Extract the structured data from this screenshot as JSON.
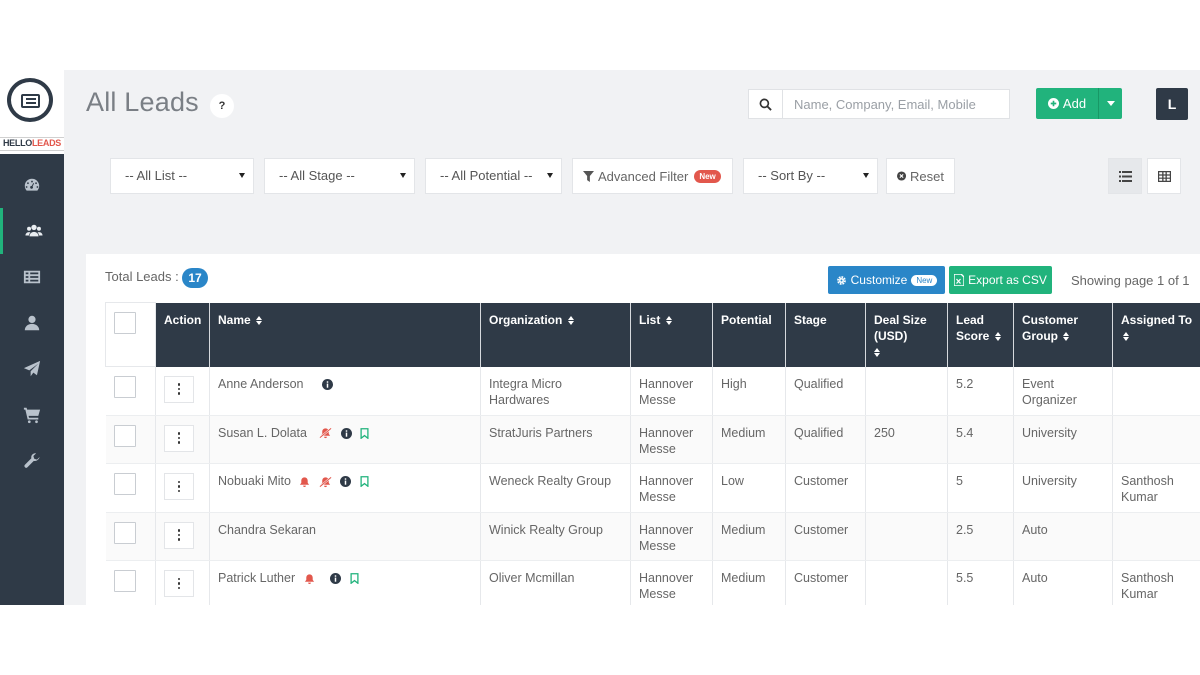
{
  "brand": {
    "name_part1": "HELLO",
    "name_part2": "LEADS"
  },
  "header": {
    "title": "All Leads",
    "help": "?",
    "search_placeholder": "Name, Company, Email, Mobile",
    "add_label": "Add",
    "user_initial": "L"
  },
  "sidebar": {
    "items": [
      {
        "icon": "dashboard-icon"
      },
      {
        "icon": "users-icon",
        "active": true
      },
      {
        "icon": "list-icon"
      },
      {
        "icon": "user-icon"
      },
      {
        "icon": "paper-plane-icon"
      },
      {
        "icon": "cart-icon"
      },
      {
        "icon": "wrench-icon"
      }
    ]
  },
  "filters": {
    "list": "-- All List --",
    "stage": "-- All Stage --",
    "potential": "-- All Potential --",
    "advanced": "Advanced Filter",
    "advanced_badge": "New",
    "sort": "-- Sort By --",
    "reset": "Reset"
  },
  "summary": {
    "total_label": "Total Leads :",
    "total": "17",
    "customize": "Customize",
    "customize_badge": "New",
    "export": "Export as CSV",
    "paging": "Showing page 1 of 1"
  },
  "table": {
    "headers": {
      "action": "Action",
      "name": "Name",
      "organization": "Organization",
      "list": "List",
      "potential": "Potential",
      "stage": "Stage",
      "deal_size": "Deal Size (USD)",
      "lead_score": "Lead Score",
      "customer_group": "Customer Group",
      "assigned_to": "Assigned To"
    },
    "rows": [
      {
        "name": "Anne Anderson",
        "organization": "Integra Micro Hardwares",
        "list": "Hannover Messe",
        "potential": "High",
        "stage": "Qualified",
        "deal_size": "",
        "lead_score": "5.2",
        "customer_group": "Event Organizer",
        "assigned_to": ""
      },
      {
        "name": "Susan L. Dolata",
        "organization": "StratJuris Partners",
        "list": "Hannover Messe",
        "potential": "Medium",
        "stage": "Qualified",
        "deal_size": "250",
        "lead_score": "5.4",
        "customer_group": "University",
        "assigned_to": ""
      },
      {
        "name": "Nobuaki Mito",
        "organization": "Weneck Realty Group",
        "list": "Hannover Messe",
        "potential": "Low",
        "stage": "Customer",
        "deal_size": "",
        "lead_score": "5",
        "customer_group": "University",
        "assigned_to": "Santhosh Kumar"
      },
      {
        "name": "Chandra Sekaran",
        "organization": "Winick Realty Group",
        "list": "Hannover Messe",
        "potential": "Medium",
        "stage": "Customer",
        "deal_size": "",
        "lead_score": "2.5",
        "customer_group": "Auto",
        "assigned_to": ""
      },
      {
        "name": "Patrick Luther",
        "organization": "Oliver Mcmillan",
        "list": "Hannover Messe",
        "potential": "Medium",
        "stage": "Customer",
        "deal_size": "",
        "lead_score": "5.5",
        "customer_group": "Auto",
        "assigned_to": "Santhosh Kumar"
      }
    ]
  },
  "colors": {
    "sidebar": "#2f3a47",
    "accent_green": "#21b37c",
    "accent_blue": "#2a86c8",
    "alert_red": "#e2574c"
  }
}
